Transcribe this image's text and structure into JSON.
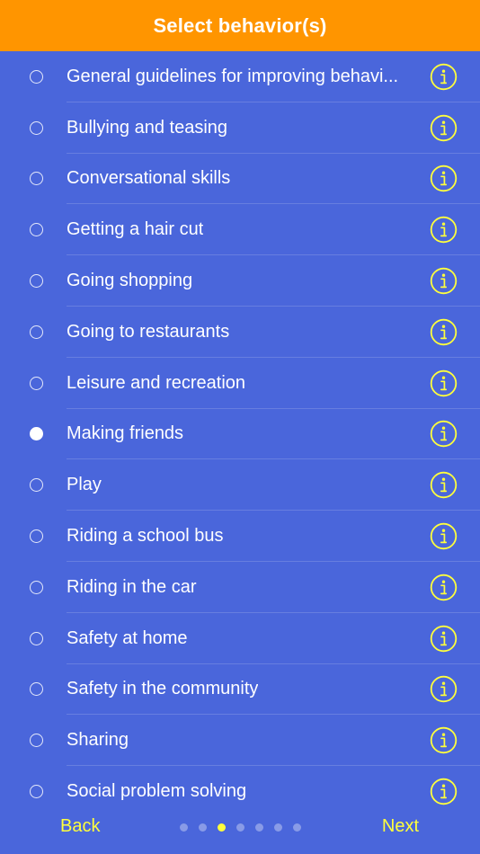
{
  "header": {
    "title": "Select behavior(s)"
  },
  "colors": {
    "background": "#4A66DB",
    "header": "#FF9500",
    "accent": "#FFFF3C",
    "text": "#FFFFFF"
  },
  "behaviors": [
    {
      "label": "General guidelines for improving behavi...",
      "selected": false
    },
    {
      "label": "Bullying and teasing",
      "selected": false
    },
    {
      "label": "Conversational skills",
      "selected": false
    },
    {
      "label": "Getting a hair cut",
      "selected": false
    },
    {
      "label": "Going shopping",
      "selected": false
    },
    {
      "label": "Going to restaurants",
      "selected": false
    },
    {
      "label": "Leisure and recreation",
      "selected": false
    },
    {
      "label": "Making friends",
      "selected": true
    },
    {
      "label": "Play",
      "selected": false
    },
    {
      "label": "Riding a school bus",
      "selected": false
    },
    {
      "label": "Riding in the car",
      "selected": false
    },
    {
      "label": "Safety at home",
      "selected": false
    },
    {
      "label": "Safety in the community",
      "selected": false
    },
    {
      "label": "Sharing",
      "selected": false
    },
    {
      "label": "Social problem solving",
      "selected": false
    }
  ],
  "info_icon": "info-circle-icon",
  "footer": {
    "back_label": "Back",
    "next_label": "Next",
    "page_count": 7,
    "current_page": 3
  }
}
